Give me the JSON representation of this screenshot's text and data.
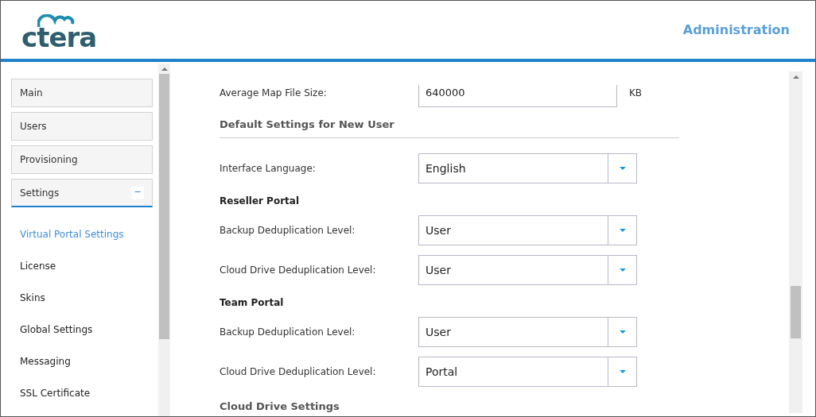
{
  "header": {
    "logo": "ctera",
    "title": "Administration"
  },
  "sidebar": {
    "items": [
      {
        "label": "Main",
        "selected": false
      },
      {
        "label": "Users",
        "selected": false
      },
      {
        "label": "Provisioning",
        "selected": false
      },
      {
        "label": "Settings",
        "selected": true,
        "expanded": true,
        "toggle": "−",
        "children": [
          {
            "label": "Virtual Portal Settings",
            "selected": true
          },
          {
            "label": "License",
            "selected": false
          },
          {
            "label": "Skins",
            "selected": false
          },
          {
            "label": "Global Settings",
            "selected": false
          },
          {
            "label": "Messaging",
            "selected": false
          },
          {
            "label": "SSL Certificate",
            "selected": false
          }
        ]
      }
    ]
  },
  "content": {
    "rows": [
      {
        "kind": "field",
        "label": "Average Map File Size:",
        "value": "640000",
        "unit": "KB"
      },
      {
        "kind": "heading",
        "label": "Default Settings for New User"
      },
      {
        "kind": "select",
        "label": "Interface Language:",
        "value": "English"
      },
      {
        "kind": "subheading",
        "label": "Reseller Portal"
      },
      {
        "kind": "select",
        "label": "Backup Deduplication Level:",
        "value": "User"
      },
      {
        "kind": "select",
        "label": "Cloud Drive Deduplication Level:",
        "value": "User"
      },
      {
        "kind": "subheading",
        "label": "Team Portal"
      },
      {
        "kind": "select",
        "label": "Backup Deduplication Level:",
        "value": "User"
      },
      {
        "kind": "select",
        "label": "Cloud Drive Deduplication Level:",
        "value": "Portal"
      },
      {
        "kind": "heading",
        "label": "Cloud Drive Settings"
      }
    ]
  }
}
